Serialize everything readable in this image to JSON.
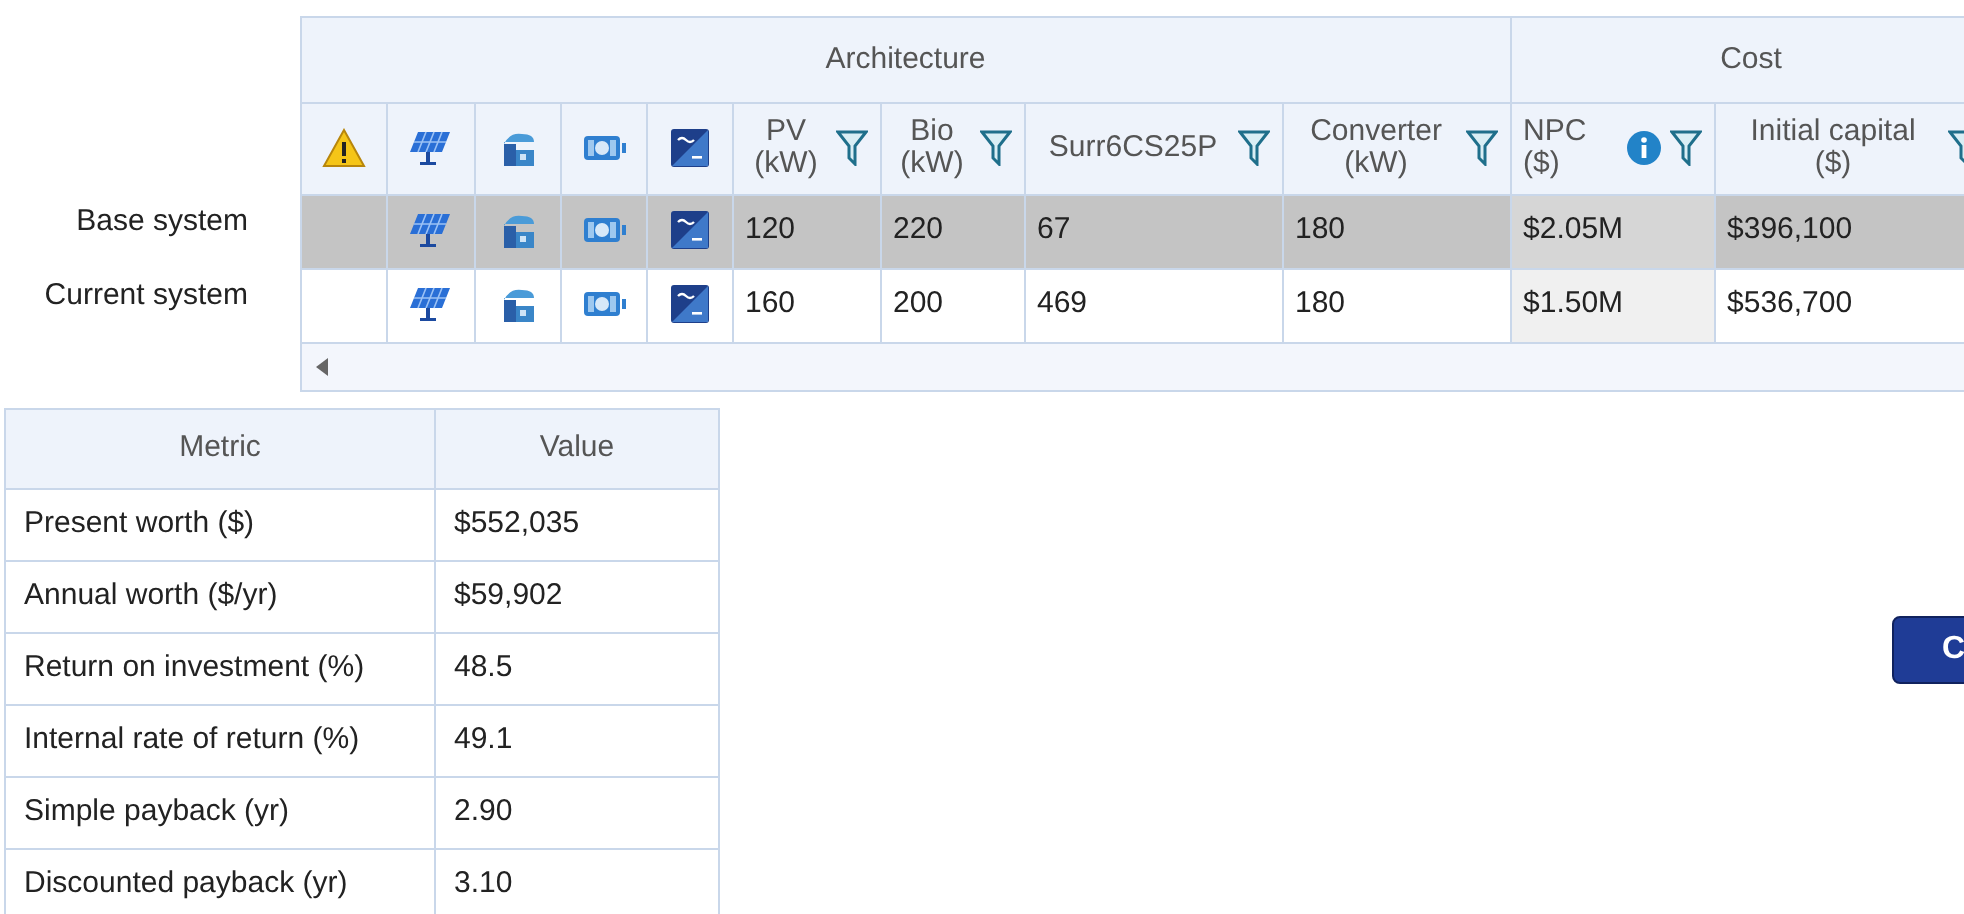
{
  "grid": {
    "groups": [
      {
        "label": "Architecture",
        "columns": [
          {
            "kind": "warning"
          },
          {
            "kind": "pv"
          },
          {
            "kind": "generator"
          },
          {
            "kind": "storage"
          },
          {
            "kind": "converter"
          },
          {
            "kind": "text",
            "label": "PV",
            "unit": "(kW)",
            "filter": true
          },
          {
            "kind": "text",
            "label": "Bio",
            "unit": "(kW)",
            "filter": true
          },
          {
            "kind": "text",
            "label": "Surr6CS25P",
            "filter": true
          },
          {
            "kind": "text",
            "label": "Converter",
            "unit": "(kW)",
            "filter": true
          }
        ]
      },
      {
        "label": "Cost",
        "columns": [
          {
            "kind": "text",
            "label": "NPC",
            "unit": "($)",
            "filter": true,
            "info": true,
            "shaded": true
          },
          {
            "kind": "text",
            "label": "Initial capital",
            "unit": "($)",
            "filter": true
          }
        ]
      }
    ],
    "rows": [
      {
        "label": "Base system",
        "selected": true,
        "values": [
          "120",
          "220",
          "67",
          "180",
          "$2.05M",
          "$396,100"
        ]
      },
      {
        "label": "Current system",
        "selected": false,
        "values": [
          "160",
          "200",
          "469",
          "180",
          "$1.50M",
          "$536,700"
        ]
      }
    ]
  },
  "metrics": {
    "columns": [
      "Metric",
      "Value"
    ],
    "rows": [
      [
        "Present worth ($)",
        "$552,035"
      ],
      [
        "Annual worth ($/yr)",
        "$59,902"
      ],
      [
        "Return on investment (%)",
        "48.5"
      ],
      [
        "Internal rate of return (%)",
        "49.1"
      ],
      [
        "Simple payback (yr)",
        "2.90"
      ],
      [
        "Discounted payback (yr)",
        "3.10"
      ]
    ]
  },
  "button": {
    "label": "C"
  }
}
